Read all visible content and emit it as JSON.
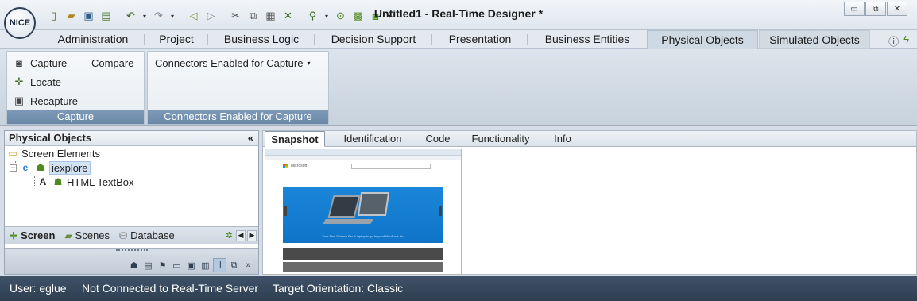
{
  "app": {
    "title": "Untitled1 - Real-Time Designer *",
    "logo_text": "NICE"
  },
  "quick_access": [
    "new-icon",
    "open-icon",
    "save-icon",
    "save-as-icon",
    "undo-icon",
    "redo-icon",
    "back-icon",
    "forward-icon",
    "cut-icon",
    "copy-icon",
    "paste-icon",
    "delete-icon",
    "find-icon",
    "run-icon",
    "debug-icon",
    "snapshot-icon"
  ],
  "window_controls": {
    "minimize": "▭",
    "restore": "⧉",
    "close": "✕"
  },
  "ribbon_tabs": [
    {
      "label": "Administration"
    },
    {
      "label": "Project"
    },
    {
      "label": "Business Logic"
    },
    {
      "label": "Decision Support"
    },
    {
      "label": "Presentation"
    },
    {
      "label": "Business Entities"
    },
    {
      "label": "Physical Objects",
      "active": true
    },
    {
      "label": "Simulated Objects"
    }
  ],
  "ribbon": {
    "capture_group": {
      "caption": "Capture",
      "capture": "Capture",
      "compare": "Compare",
      "locate": "Locate",
      "recapture": "Recapture"
    },
    "connectors_group": {
      "caption": "Connectors Enabled for Capture",
      "dropdown": "Connectors Enabled for Capture"
    }
  },
  "left_pane": {
    "title": "Physical Objects",
    "collapse": "«",
    "tree": {
      "root": "Screen Elements",
      "child": "iexplore",
      "grandchild": "HTML TextBox"
    },
    "tabs": [
      "Screen",
      "Scenes",
      "Database"
    ]
  },
  "right_pane": {
    "tabs": [
      "Snapshot",
      "Identification",
      "Code",
      "Functionality",
      "Info"
    ],
    "snapshot_caption": "Your Five Surface Pro 4 laptop to go beyond MacBook Air"
  },
  "status": {
    "user": "User: eglue",
    "connection": "Not Connected to Real-Time Server",
    "orientation": "Target Orientation: Classic"
  }
}
